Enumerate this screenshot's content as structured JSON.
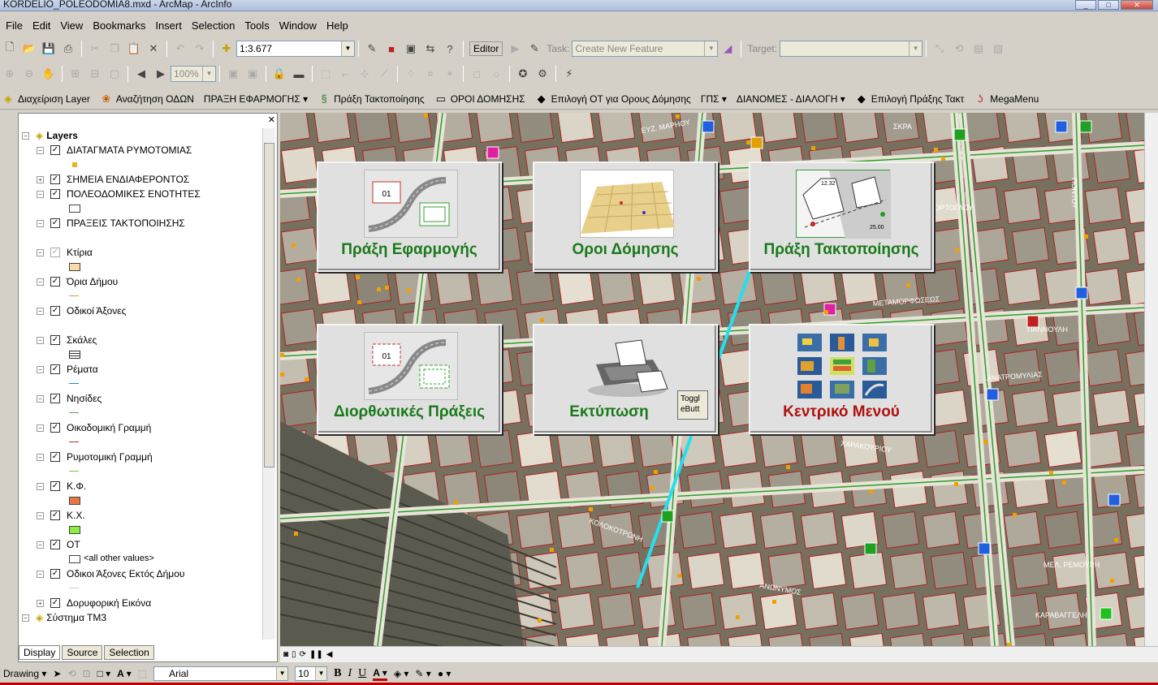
{
  "window": {
    "title": "KORDELIO_POLEODOMIA8.mxd - ArcMap - ArcInfo",
    "min": "_",
    "max": "□",
    "close": "✕"
  },
  "menubar": [
    "File",
    "Edit",
    "View",
    "Bookmarks",
    "Insert",
    "Selection",
    "Tools",
    "Window",
    "Help"
  ],
  "toolbar1": {
    "scale": "1:3.677",
    "editor_label": "Editor",
    "task_label": "Task:",
    "task_value": "Create New Feature",
    "target_label": "Target:",
    "target_value": ""
  },
  "toolbar2": {
    "zoom": "100%"
  },
  "toolbar3": [
    {
      "label": "Διαχείριση Layer",
      "icon": "layers-icon",
      "glyph": "◈"
    },
    {
      "label": "Αναζήτηση ΟΔΩΝ",
      "icon": "search-roads-icon",
      "glyph": "❀"
    },
    {
      "label": "ΠΡΑΞΗ ΕΦΑΡΜΟΓΗΣ ▾",
      "icon": "",
      "glyph": ""
    },
    {
      "label": "Πράξη Τακτοποίησης",
      "icon": "regularization-icon",
      "glyph": "§"
    },
    {
      "label": "ΟΡΟΙ ΔΟΜΗΣΗΣ",
      "icon": "building-terms-icon",
      "glyph": "▭"
    },
    {
      "label": "Επιλογή ΟΤ για Ορους Δόμησης",
      "icon": "select-block-icon",
      "glyph": "◆"
    },
    {
      "label": "ΓΠΣ ▾",
      "icon": "",
      "glyph": ""
    },
    {
      "label": "ΔΙΑΝΟΜΕΣ - ΔΙΑΛΟΓΗ ▾",
      "icon": "",
      "glyph": ""
    },
    {
      "label": "Επιλογή Πράξης Τακτ",
      "icon": "select-action-icon",
      "glyph": "◆"
    },
    {
      "label": "MegaMenu",
      "icon": "megamenu-icon",
      "glyph": "ʖ"
    }
  ],
  "toc": {
    "root_label": "Layers",
    "layers": [
      {
        "name": "ΔΙΑΤΑΓΜΑΤΑ ΡΥΜΟΤΟΜΙΑΣ",
        "expand": "−",
        "checked": true,
        "swatch": "dot",
        "color": "#e8b020"
      },
      {
        "name": "ΣΗΜΕΙΑ ΕΝΔΙΑΦΕΡΟΝΤΟΣ",
        "expand": "+",
        "checked": true,
        "swatch": "none",
        "color": ""
      },
      {
        "name": "ΠΟΛΕΟΔΟΜΙΚΕΣ ΕΝΟΤΗΤΕΣ",
        "expand": "−",
        "checked": true,
        "swatch": "box",
        "color": "#ffffff"
      },
      {
        "name": "ΠΡΑΞΕΙΣ ΤΑΚΤΟΠΟΙΗΣΗΣ",
        "expand": "−",
        "checked": true,
        "swatch": "blank",
        "color": ""
      },
      {
        "name": "Κτίρια",
        "expand": "−",
        "checked": true,
        "grey": true,
        "swatch": "box",
        "color": "#f8dba8"
      },
      {
        "name": "Όρια Δήμου",
        "expand": "−",
        "checked": true,
        "swatch": "line",
        "color": "#c8a060"
      },
      {
        "name": "Οδικοί Άξονες",
        "expand": "−",
        "checked": true,
        "swatch": "blank",
        "color": ""
      },
      {
        "name": "Σκάλες",
        "expand": "−",
        "checked": true,
        "swatch": "hatch",
        "color": "#333333"
      },
      {
        "name": "Ρέματα",
        "expand": "−",
        "checked": true,
        "swatch": "line",
        "color": "#2288cc"
      },
      {
        "name": "Νησίδες",
        "expand": "−",
        "checked": true,
        "swatch": "line",
        "color": "#55aa55"
      },
      {
        "name": "Οικοδομική Γραμμή",
        "expand": "−",
        "checked": true,
        "swatch": "line",
        "color": "#cc2222"
      },
      {
        "name": "Ρυμοτομική Γραμμή",
        "expand": "−",
        "checked": true,
        "swatch": "line",
        "color": "#66cc44"
      },
      {
        "name": "Κ.Φ.",
        "expand": "−",
        "checked": true,
        "swatch": "fill",
        "color": "#e87840"
      },
      {
        "name": "Κ.Χ.",
        "expand": "−",
        "checked": true,
        "swatch": "fill",
        "color": "#88ee44"
      },
      {
        "name": "ΟΤ",
        "expand": "−",
        "checked": true,
        "swatch": "other",
        "color": "#ffffff",
        "other_label": "<all other values>"
      },
      {
        "name": "Οδικοι Άξονες Εκτός Δήμου",
        "expand": "−",
        "checked": true,
        "swatch": "line",
        "color": "#cccccc"
      },
      {
        "name": "Δορυφορική Εικόνα",
        "expand": "+",
        "checked": true,
        "swatch": "none",
        "color": ""
      }
    ],
    "system_label": "Σύστημα ΤΜ3",
    "tabs": [
      "Display",
      "Source",
      "Selection"
    ]
  },
  "map_streets": [
    {
      "name": "ΕΥΖ. ΜΑΡΗΟΥ"
    },
    {
      "name": "ΣΚΡΑ"
    },
    {
      "name": "ΜΕΤΑΜΟΡΦΩΣΕΩΣ"
    },
    {
      "name": "ΠΑΝΝΟΥΛΗ"
    },
    {
      "name": "ΑΝΑΤΡΟΜΥΛΙΑΣ"
    },
    {
      "name": "ΧΑΡΑΚΟΥΡΙΟΥ"
    },
    {
      "name": "ΚΟΛΟΚΟΤΡΩΝΗ"
    },
    {
      "name": "ΑΝΩΝΥΜΟΣ"
    },
    {
      "name": "ΜΕΛ. ΡΕΜΟΥΡΗ"
    },
    {
      "name": "ΚΑΡΑΒΑΓΓΕΛΗ"
    },
    {
      "name": "ΤΟΡΤΟΓΛΟΥ"
    },
    {
      "name": "ΠΟΝΤΟΥ"
    }
  ],
  "cards": [
    {
      "id": "praxi-efarmogis",
      "label": "Πράξη Εφαρμογής",
      "color": "#1a7a1a",
      "thumb": "01"
    },
    {
      "id": "oroi-domisis",
      "label": "Οροι Δόμησης",
      "color": "#1a7a1a",
      "thumb": ""
    },
    {
      "id": "praxi-taktopoiisis",
      "label": "Πράξη Τακτοποίησης",
      "color": "#1a7a1a",
      "thumb": "12.32",
      "thumb2": "25.00"
    },
    {
      "id": "diorthotikes-praxeis",
      "label": "Διορθωτικές Πράξεις",
      "color": "#1a7a1a",
      "thumb": "01"
    },
    {
      "id": "ektyposi",
      "label": "Εκτύπωση",
      "color": "#1a7a1a",
      "thumb": "",
      "toggle": "Toggl eButt"
    },
    {
      "id": "kentriko-menou",
      "label": "Κεντρικό Μενού",
      "color": "#b01010",
      "thumb": ""
    }
  ],
  "drawbar": {
    "drawing_label": "Drawing ▾",
    "font": "Arial",
    "size": "10",
    "bold": "B",
    "italic": "I",
    "underline": "U"
  }
}
